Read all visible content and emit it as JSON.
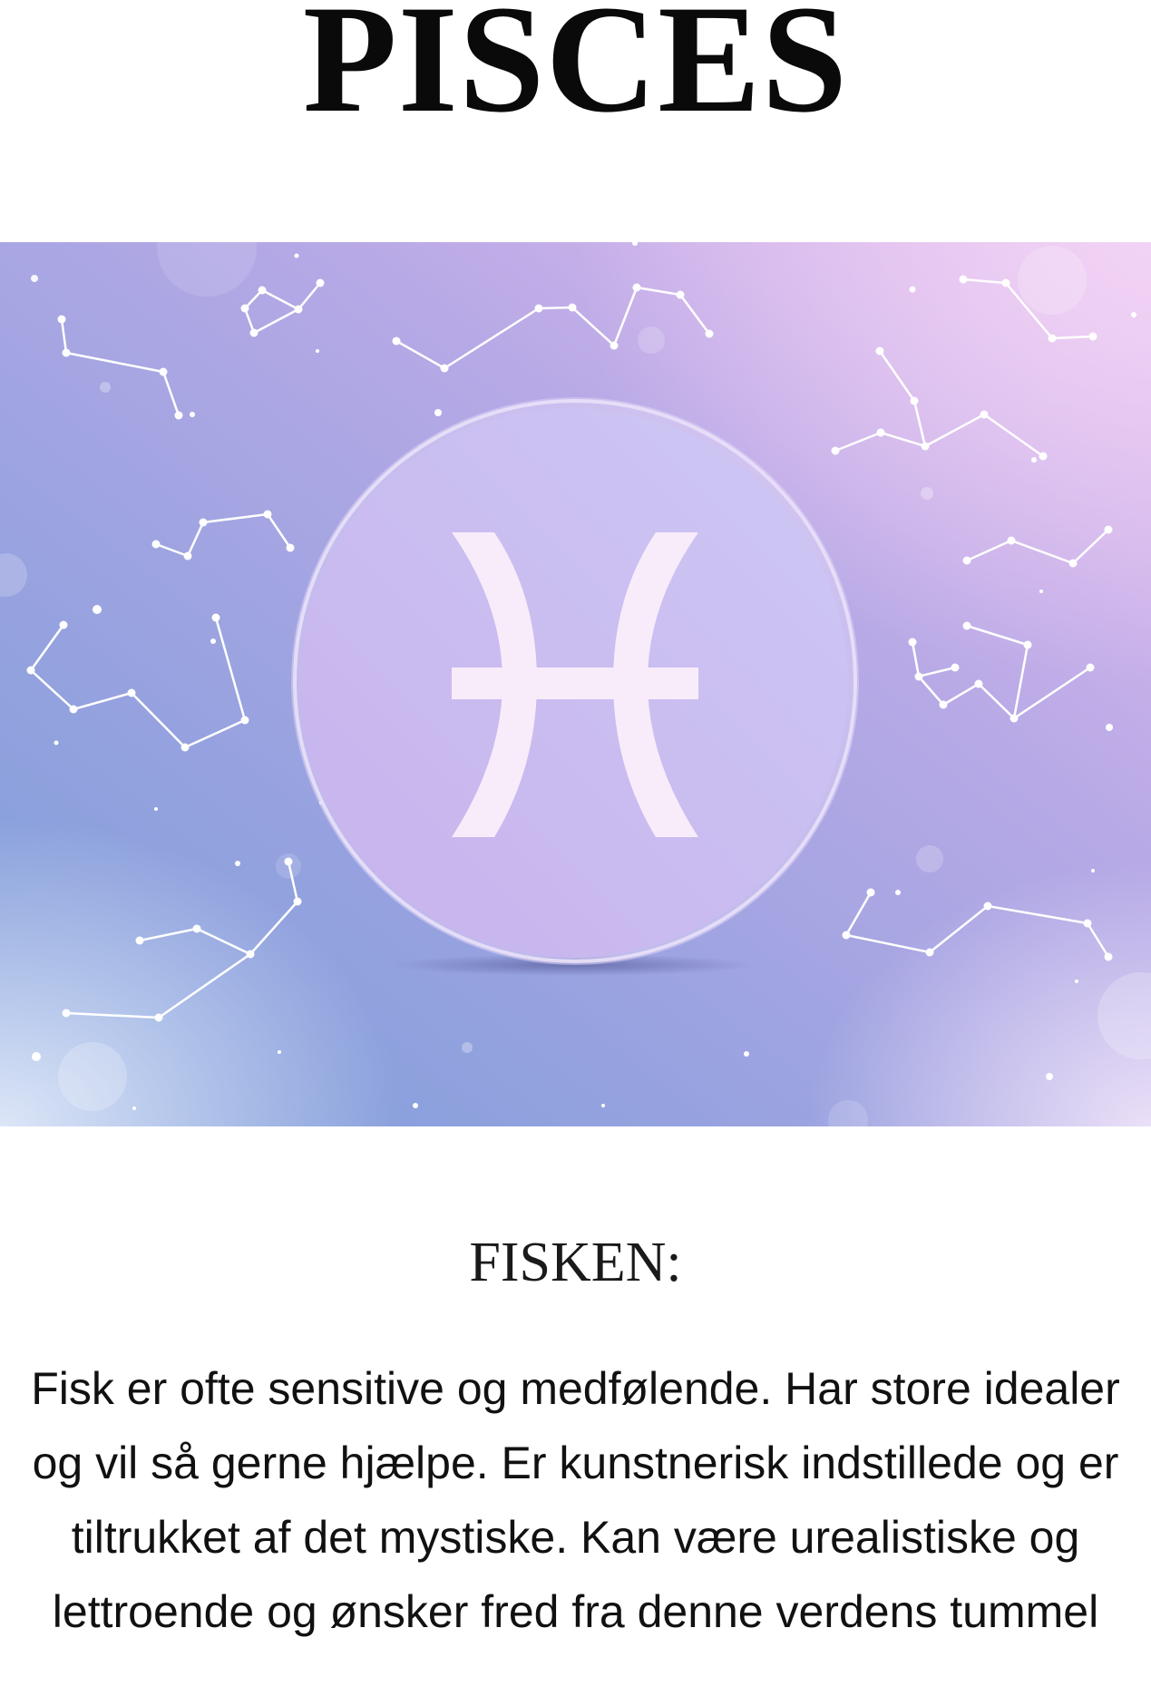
{
  "page": {
    "title": "PISCES",
    "subtitle": "FISKEN:",
    "description": "Fisk er ofte sensitive og medfølende. Har store idealer og vil så gerne hjælpe. Er kunstnerisk indstillede og er tiltrukket af det mystiske. Kan være urealistiske og lettroende og ønsker fred fra denne verdens tummel"
  },
  "banner": {
    "icon": "pisces-symbol-icon",
    "background_icon": "constellation-icon",
    "colors": {
      "gradient_start": "#7fa3dc",
      "gradient_mid": "#b3a8e4",
      "gradient_end": "#e3b9ee",
      "disc": "#cbb9ef",
      "symbol": "#f8ecfb",
      "stars": "#ffffff"
    }
  }
}
